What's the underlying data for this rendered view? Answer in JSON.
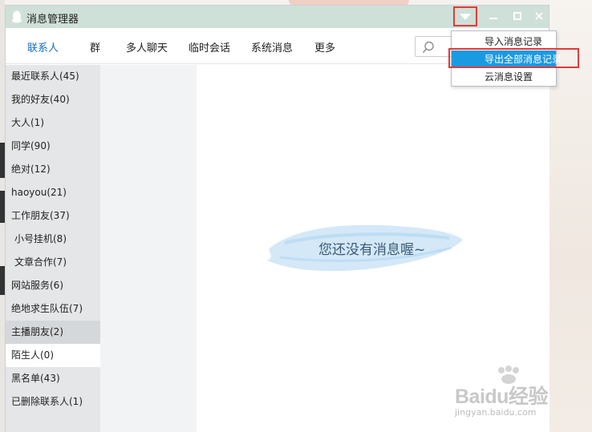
{
  "window": {
    "title": "消息管理器"
  },
  "tabs": [
    {
      "label": "联系人",
      "active": true
    },
    {
      "label": "群"
    },
    {
      "label": "多人聊天"
    },
    {
      "label": "临时会话"
    },
    {
      "label": "系统消息"
    },
    {
      "label": "更多"
    }
  ],
  "sidebar": {
    "items": [
      {
        "label": "最近联系人(45)"
      },
      {
        "label": "我的好友(40)"
      },
      {
        "label": "大人(1)"
      },
      {
        "label": "同学(90)"
      },
      {
        "label": "绝对(12)"
      },
      {
        "label": "haoyou(21)"
      },
      {
        "label": "工作朋友(37)"
      },
      {
        "label": " 小号挂机(8)"
      },
      {
        "label": " 文章合作(7)"
      },
      {
        "label": "网站服务(6)"
      },
      {
        "label": "绝地求生队伍(7)"
      },
      {
        "label": "主播朋友(2)",
        "state": "hover"
      },
      {
        "label": "陌生人(0)",
        "state": "selected"
      },
      {
        "label": "黑名单(43)"
      },
      {
        "label": "已删除联系人(1)"
      }
    ]
  },
  "content": {
    "empty_message": "您还没有消息喔~"
  },
  "dropdown_menu": {
    "items": [
      {
        "label": "导入消息记录"
      },
      {
        "label": "导出全部消息记录",
        "highlighted": true
      },
      {
        "label": "云消息设置"
      }
    ]
  },
  "watermark": {
    "logo": "Baidu经验",
    "url": "jingyan.baidu.com"
  },
  "colors": {
    "titlebar": "#cfe0d8",
    "active_tab": "#1a6fc2",
    "menu_highlight": "#1c9ae1",
    "annotation_outline": "#e03b3b",
    "sidebar_bg": "#e4e6e7"
  },
  "icons": {
    "app": "qq-penguin-icon",
    "menu": "triangle-down-icon",
    "minimize": "minimize-icon",
    "maximize": "maximize-icon",
    "close": "close-icon",
    "search": "search-icon"
  }
}
